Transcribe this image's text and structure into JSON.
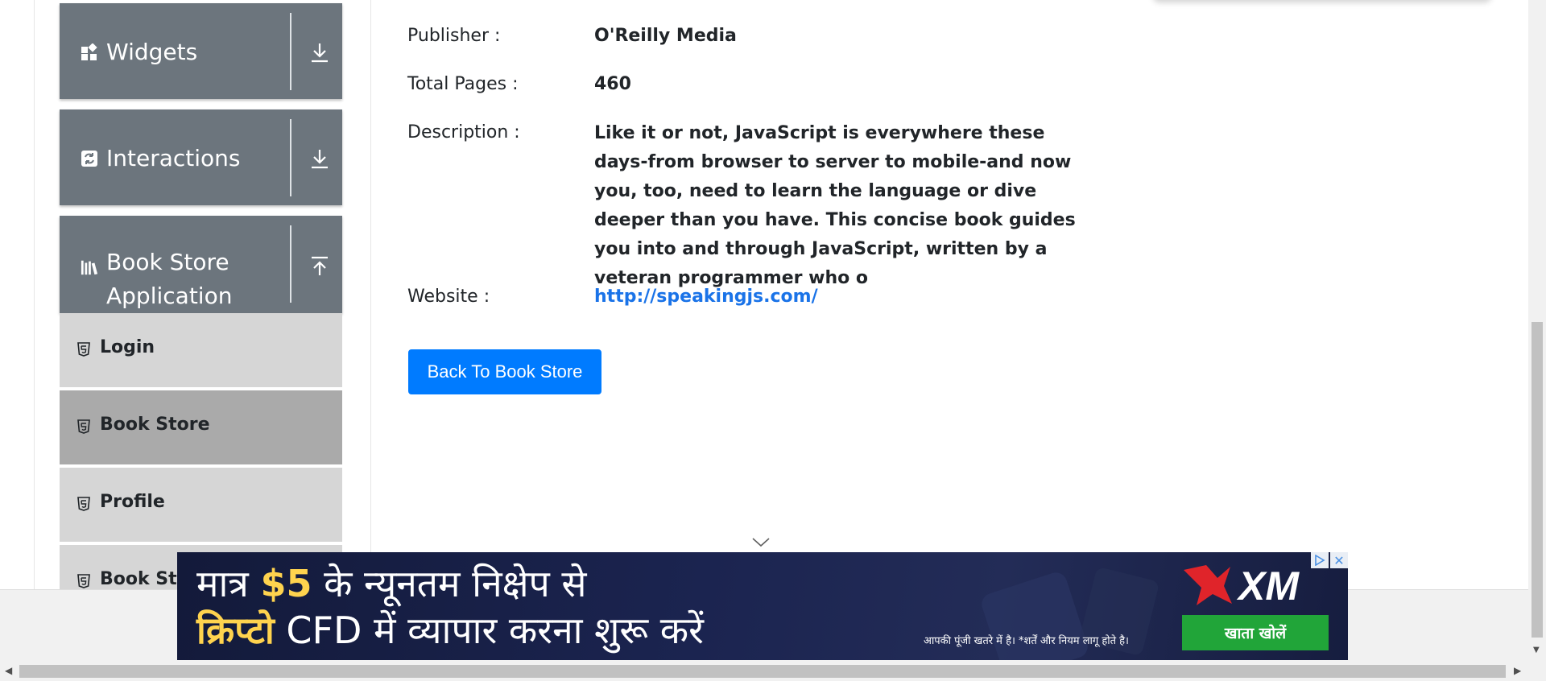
{
  "sidebar": {
    "groups": [
      {
        "label": "Widgets",
        "icon": "widgets-icon",
        "toggle_icon": "download-arrow-icon"
      },
      {
        "label": "Interactions",
        "icon": "interactions-icon",
        "toggle_icon": "download-arrow-icon"
      },
      {
        "label_line1": "Book Store",
        "label_line2": "Application",
        "icon": "books-icon",
        "toggle_icon": "upload-arrow-icon"
      }
    ],
    "book_store_items": [
      {
        "label": "Login",
        "icon": "html5-icon"
      },
      {
        "label": "Book Store",
        "icon": "html5-icon",
        "active": true
      },
      {
        "label": "Profile",
        "icon": "html5-icon"
      },
      {
        "label": "Book Store API",
        "icon": "html5-icon"
      }
    ]
  },
  "book": {
    "publisher_label": "Publisher :",
    "publisher": "O'Reilly Media",
    "pages_label": "Total Pages :",
    "pages": "460",
    "description_label": "Description :",
    "description": "Like it or not, JavaScript is everywhere these days-from browser to server to mobile-and now you, too, need to learn the language or dive deeper than you have. This concise book guides you into and through JavaScript, written by a veteran programmer who o",
    "website_label": "Website :",
    "website": "http://speakingjs.com/"
  },
  "actions": {
    "back_label": "Back To Book Store"
  },
  "ad": {
    "line1_pre": "मात्र ",
    "line1_amount": "$5",
    "line1_post": " के न्यूनतम निक्षेप से",
    "line2_crypto": "क्रिप्टो",
    "line2_post": " CFD में  व्यापार करना शुरू करें",
    "brand": "XM",
    "disclaimer": "आपकी पूंजी खतरे में है। *शर्तें और नियम लागू होते है।",
    "cta": "खाता खोलें",
    "close": "✕"
  },
  "colors": {
    "sidebar_header": "#6c757d",
    "sub_item": "#d6d6d6",
    "sub_item_active": "#aaaaaa",
    "primary_button": "#007bff",
    "link": "#1a73e8",
    "ad_background": "#1b2450",
    "ad_highlight": "#ffd34e",
    "ad_cta": "#21a539",
    "brand_red": "#e0242a"
  }
}
